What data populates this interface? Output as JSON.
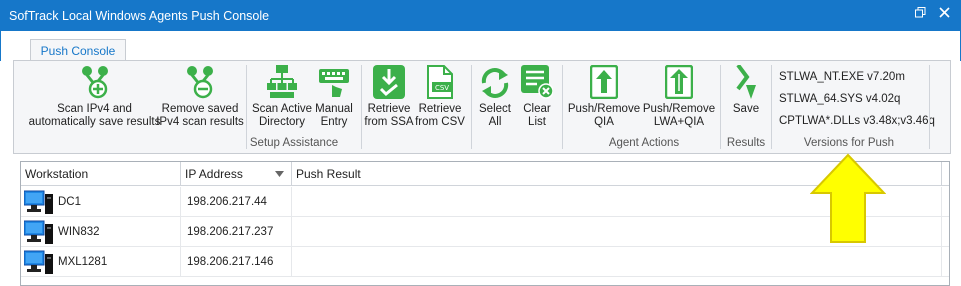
{
  "window": {
    "title": "SofTrack Local Windows Agents Push Console"
  },
  "tabs": [
    {
      "label": "Push Console",
      "active": true
    }
  ],
  "ribbon": {
    "buttons": [
      {
        "label_line1": "Scan IPv4 and",
        "label_line2": "automatically save results",
        "icon": "network-add-icon"
      },
      {
        "label_line1": "Remove saved",
        "label_line2": "IPv4 scan results",
        "icon": "network-remove-icon"
      },
      {
        "label_line1": "Scan Active",
        "label_line2": "Directory",
        "icon": "active-directory-icon"
      },
      {
        "label_line1": "Manual",
        "label_line2": "Entry",
        "icon": "keyboard-hand-icon"
      },
      {
        "label_line1": "Retrieve",
        "label_line2": "from SSA",
        "icon": "download-check-icon"
      },
      {
        "label_line1": "Retrieve",
        "label_line2": "from CSV",
        "icon": "csv-file-icon"
      },
      {
        "label_line1": "Select",
        "label_line2": "All",
        "icon": "refresh-arrows-icon"
      },
      {
        "label_line1": "Clear",
        "label_line2": "List",
        "icon": "clear-list-icon"
      },
      {
        "label_line1": "Push/Remove",
        "label_line2": "QIA",
        "icon": "push-qia-icon"
      },
      {
        "label_line1": "Push/Remove",
        "label_line2": "LWA+QIA",
        "icon": "push-lwa-qia-icon"
      },
      {
        "label_line1": "Save",
        "label_line2": "",
        "icon": "save-chevron-icon"
      }
    ],
    "groups": {
      "setup": "Setup Assistance",
      "agent": "Agent Actions",
      "results": "Results",
      "versions": "Versions for Push"
    },
    "versions": [
      "STLWA_NT.EXE v7.20m",
      "STLWA_64.SYS v4.02q",
      "CPTLWA*.DLLs v3.48x;v3.46q"
    ]
  },
  "grid": {
    "columns": [
      "Workstation",
      "IP Address",
      "Push Result"
    ],
    "rows": [
      {
        "workstation": "DC1",
        "ip": "198.206.217.44",
        "result": ""
      },
      {
        "workstation": "WIN832",
        "ip": "198.206.217.237",
        "result": ""
      },
      {
        "workstation": "MXL1281",
        "ip": "198.206.217.146",
        "result": ""
      }
    ]
  },
  "colors": {
    "titlebar": "#1677c9",
    "icon_green": "#3cb04a",
    "arrow_yellow": "#ffff00"
  }
}
